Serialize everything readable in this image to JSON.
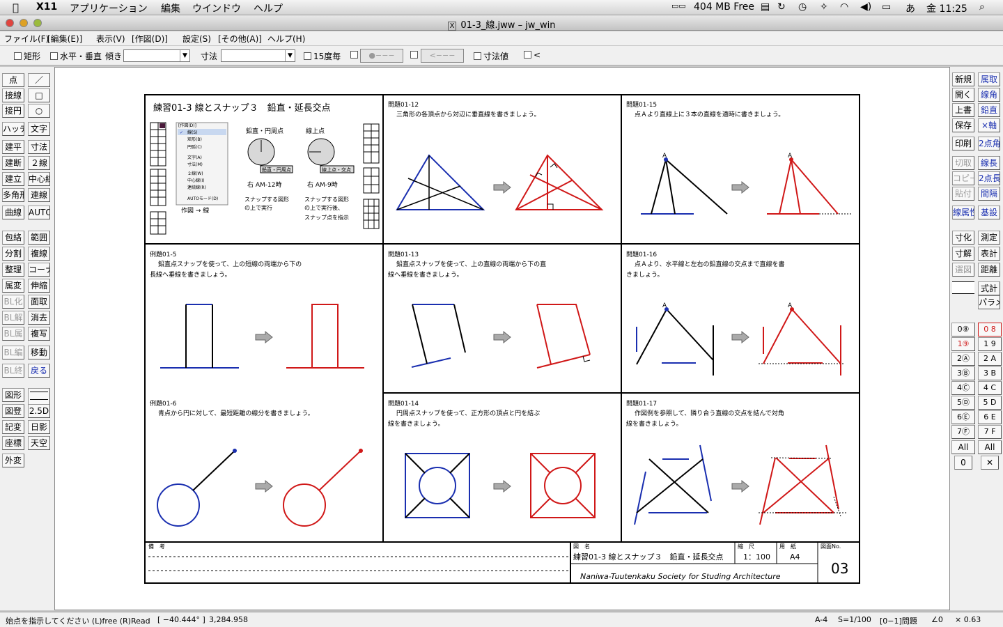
{
  "mac_menu": {
    "app": "X11",
    "items": [
      "アプリケーション",
      "編集",
      "ウインドウ",
      "ヘルプ"
    ],
    "memory": "404 MB Free",
    "ime": "あ",
    "clock": "金 11:25"
  },
  "window": {
    "title": "01-3_線.jww – jw_win"
  },
  "jw_menu": [
    "ファイル(F)",
    "[編集(E)]",
    "表示(V)",
    "[作図(D)]",
    "設定(S)",
    "[その他(A)]",
    "ヘルプ(H)"
  ],
  "options": {
    "rect": "矩形",
    "hv": "水平・垂直",
    "tilt": "傾き",
    "dim": "寸法",
    "deg15": "15度毎",
    "btn1": "●−−−",
    "btn2": "<−−−",
    "dimval": "寸法値",
    "lt": "<"
  },
  "left_tools": [
    [
      "点",
      "／"
    ],
    [
      "接線",
      "□"
    ],
    [
      "接円",
      "○"
    ],
    [
      "ハッチ",
      "文字"
    ],
    [
      "建平",
      "寸法"
    ],
    [
      "建断",
      "２線"
    ],
    [
      "建立",
      "中心線"
    ],
    [
      "多角形",
      "連線"
    ],
    [
      "曲線",
      "AUTO"
    ],
    [
      "包絡",
      "範囲"
    ],
    [
      "分割",
      "複線"
    ],
    [
      "整理",
      "コーナー"
    ],
    [
      "属変",
      "伸縮"
    ],
    [
      "BL化",
      "面取"
    ],
    [
      "BL解",
      "消去"
    ],
    [
      "BL属",
      "複写"
    ],
    [
      "BL編",
      "移動"
    ],
    [
      "BL終",
      "戻る"
    ],
    [
      "図形",
      ""
    ],
    [
      "図登",
      "2.5D"
    ],
    [
      "記変",
      "日影"
    ],
    [
      "座標",
      "天空"
    ],
    [
      "外変",
      ""
    ]
  ],
  "right_tools": [
    [
      "新規",
      "属取"
    ],
    [
      "開く",
      "線角"
    ],
    [
      "上書",
      "鉛直"
    ],
    [
      "保存",
      "×軸"
    ],
    [
      "印刷",
      "2点角"
    ],
    [
      "切取",
      "線長"
    ],
    [
      "コピー",
      "2点長"
    ],
    [
      "貼付",
      "間隔"
    ],
    [
      "線属性",
      "基設"
    ],
    [
      "寸化",
      "測定"
    ],
    [
      "寸解",
      "表計"
    ],
    [
      "選図",
      "距離"
    ],
    [
      "",
      "式計"
    ],
    [
      "",
      "パラメ"
    ]
  ],
  "layers": {
    "left": [
      "0⑧",
      "1⑨",
      "2Ⓐ",
      "3Ⓑ",
      "4Ⓒ",
      "5Ⓓ",
      "6Ⓔ",
      "7Ⓕ"
    ],
    "right": [
      "0 8",
      "1 9",
      "2 A",
      "3 B",
      "4 C",
      "5 D",
      "6 E",
      "7 F"
    ],
    "all": "All",
    "zero": "0"
  },
  "drawing": {
    "header_title": "練習01-3 線とスナップ３　鉛直・延長交点",
    "submenu_title": "[作図(D)]",
    "submenu_items": [
      "線(S)",
      "矩形(B)",
      "円弧(C)",
      "文字(A)",
      "寸法(M)",
      "２線(W)",
      "中心線(I)",
      "連続線(R)",
      "AUTOモード(D)"
    ],
    "submenu_caption": "作図 → 線",
    "snap1_title": "鉛直・円周点",
    "snap1_badge": "鉛直・円周点",
    "snap1_key": "右 AM-12時",
    "snap1_desc": [
      "スナップする図形",
      "の上で実行"
    ],
    "snap2_title": "線上点",
    "snap2_badge": "線上点・交点",
    "snap2_key": "右 AM-9時",
    "snap2_desc": [
      "スナップする図形",
      "の上で実行後、",
      "スナップ点を指示"
    ],
    "q0112": {
      "label": "問題01-12",
      "text": [
        "三角形の各頂点から対辺に垂直線を書きましょう。"
      ]
    },
    "q0115": {
      "label": "問題01-15",
      "text": [
        "点Ａより直線上に３本の直線を適時に書きましょう。"
      ]
    },
    "e015": {
      "label": "例題01-5",
      "text": [
        "鉛直点スナップを使って、上の短線の両端から下の",
        "長線へ垂線を書きましょう。"
      ]
    },
    "q0113": {
      "label": "問題01-13",
      "text": [
        "鉛直点スナップを使って、上の直線の両端から下の直",
        "線へ垂線を書きましょう。"
      ]
    },
    "q0116": {
      "label": "問題01-16",
      "text": [
        "点Ａより、水平線と左右の鉛直線の交点まで直線を書",
        "きましょう。"
      ]
    },
    "e016": {
      "label": "例題01-6",
      "text": [
        "青点から円に対して、最短距離の線分を書きましょう。"
      ]
    },
    "q0114": {
      "label": "問題01-14",
      "text": [
        "円周点スナップを使って、正方形の頂点と円を結ぶ",
        "線を書きましょう。"
      ]
    },
    "q0117": {
      "label": "問題01-17",
      "text": [
        "作図例を参照して、隣り合う直線の交点を結んで対角",
        "線を書きましょう。"
      ]
    },
    "point_a": "A",
    "tb_note": "備　考",
    "tb_name_lbl": "図　名",
    "tb_name": "練習01-3 線とスナップ３　鉛直・延長交点",
    "tb_scale_lbl": "縮　尺",
    "tb_scale": "1：100",
    "tb_size_lbl": "用　紙",
    "tb_size": "A4",
    "tb_no_lbl": "図面No.",
    "tb_no": "03",
    "tb_org": "Naniwa-Tuutenkaku Society for Studing Architecture"
  },
  "status": {
    "prompt": "始点を指示してください (L)free (R)Read",
    "angle": "[ −40.444° ]",
    "coords": "3,284.958",
    "paper": "A-4",
    "scale": "S=1/100",
    "layer": "[0−1]問題",
    "angle_lbl": "∠0",
    "zoom": "× 0.63"
  }
}
